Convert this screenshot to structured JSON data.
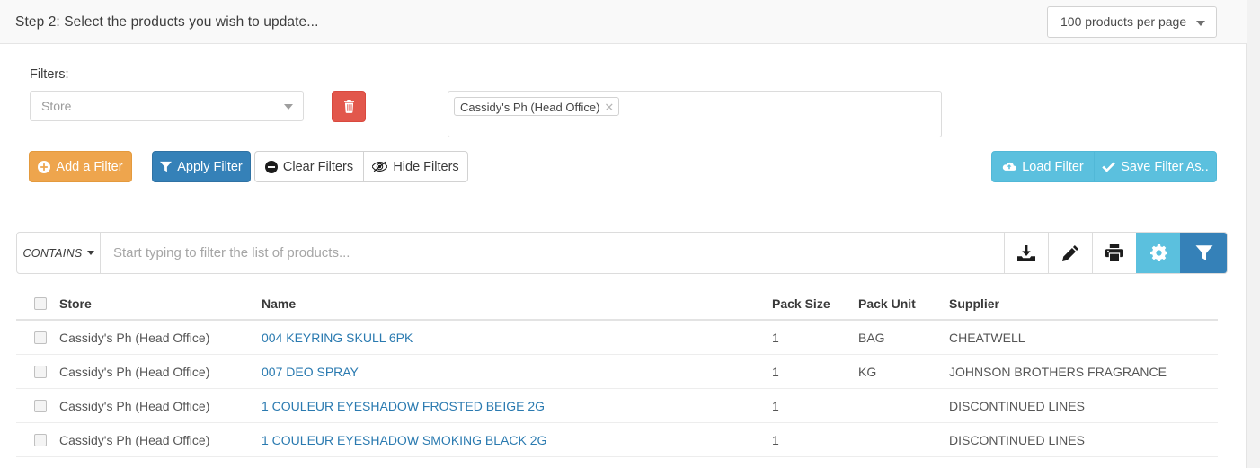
{
  "header": {
    "title": "Step 2: Select the products you wish to update...",
    "per_page_label": "100 products per page",
    "per_page_icon": "chevron-down-icon"
  },
  "filters": {
    "label": "Filters:",
    "store_select_placeholder": "Store",
    "store_select_caret_icon": "chevron-down-icon",
    "delete_filter_icon": "trash-icon",
    "selected_tags": [
      {
        "label": "Cassidy's Ph (Head Office)",
        "remove_icon": "close-icon"
      }
    ],
    "buttons": {
      "add_filter": {
        "label": "Add a Filter",
        "icon": "plus-circle-icon"
      },
      "apply_filter": {
        "label": "Apply Filter",
        "icon": "funnel-icon"
      },
      "clear_filters": {
        "label": "Clear Filters",
        "icon": "minus-circle-icon"
      },
      "hide_filters": {
        "label": "Hide Filters",
        "icon": "eye-slash-icon"
      },
      "load_filter": {
        "label": "Load Filter",
        "icon": "cloud-upload-icon"
      },
      "save_filter_as": {
        "label": "Save Filter As..",
        "icon": "check-icon"
      }
    }
  },
  "search": {
    "match_mode": "CONTAINS",
    "match_mode_icon": "caret-down-icon",
    "placeholder": "Start typing to filter the list of products...",
    "value": "",
    "tools": [
      {
        "name": "download-icon"
      },
      {
        "name": "pencil-icon"
      },
      {
        "name": "print-icon"
      },
      {
        "name": "gear-icon"
      },
      {
        "name": "funnel-icon"
      }
    ]
  },
  "table": {
    "columns": [
      "Store",
      "Name",
      "Pack Size",
      "Pack Unit",
      "Supplier"
    ],
    "select_all_checked": false,
    "rows": [
      {
        "checked": false,
        "store": "Cassidy's Ph (Head Office)",
        "name": "004 KEYRING SKULL 6PK",
        "pack_size": "1",
        "pack_unit": "BAG",
        "supplier": "CHEATWELL"
      },
      {
        "checked": false,
        "store": "Cassidy's Ph (Head Office)",
        "name": "007 DEO SPRAY",
        "pack_size": "1",
        "pack_unit": "KG",
        "supplier": "JOHNSON BROTHERS FRAGRANCE"
      },
      {
        "checked": false,
        "store": "Cassidy's Ph (Head Office)",
        "name": "1 COULEUR EYESHADOW FROSTED BEIGE 2G",
        "pack_size": "1",
        "pack_unit": "",
        "supplier": "DISCONTINUED LINES"
      },
      {
        "checked": false,
        "store": "Cassidy's Ph (Head Office)",
        "name": "1 COULEUR EYESHADOW SMOKING BLACK 2G",
        "pack_size": "1",
        "pack_unit": "",
        "supplier": "DISCONTINUED LINES"
      }
    ]
  },
  "colors": {
    "orange": "#eea54d",
    "blue": "#3581b8",
    "light_blue": "#5bc0de",
    "red": "#e2574c",
    "link": "#2a7ab0"
  }
}
